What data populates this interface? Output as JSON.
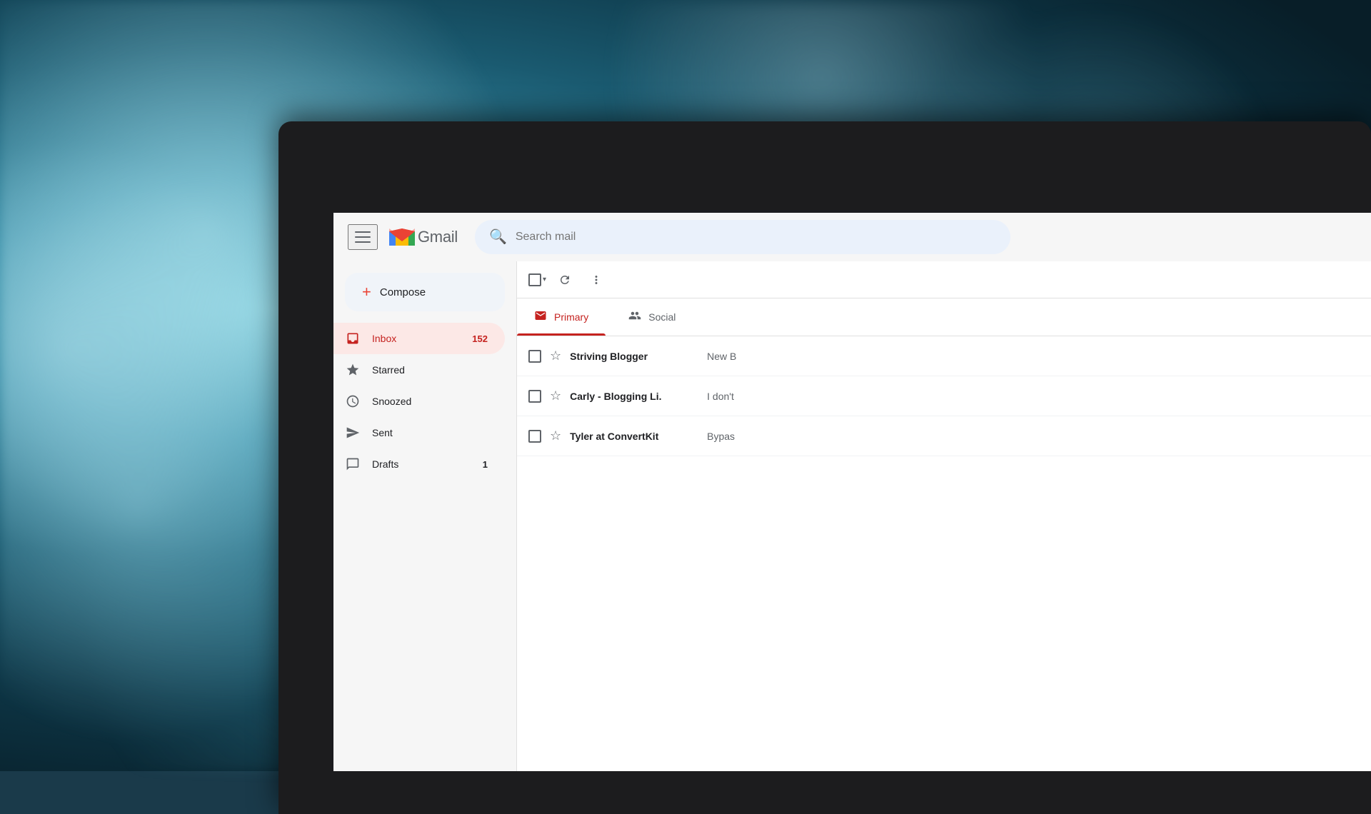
{
  "background": {
    "color": "#1a3a4a"
  },
  "gmail": {
    "app_title": "Gmail",
    "header": {
      "menu_icon": "☰",
      "search_placeholder": "Search mail"
    },
    "compose": {
      "label": "Compose",
      "plus_icon": "+"
    },
    "sidebar": {
      "items": [
        {
          "id": "inbox",
          "label": "Inbox",
          "icon": "inbox",
          "count": "152",
          "active": true
        },
        {
          "id": "starred",
          "label": "Starred",
          "icon": "star",
          "count": "",
          "active": false
        },
        {
          "id": "snoozed",
          "label": "Snoozed",
          "icon": "clock",
          "count": "",
          "active": false
        },
        {
          "id": "sent",
          "label": "Sent",
          "icon": "send",
          "count": "",
          "active": false
        },
        {
          "id": "drafts",
          "label": "Drafts",
          "icon": "drafts",
          "count": "1",
          "active": false
        }
      ]
    },
    "tabs": [
      {
        "id": "primary",
        "label": "Primary",
        "icon": "inbox",
        "active": true
      },
      {
        "id": "social",
        "label": "Social",
        "icon": "people",
        "active": false
      }
    ],
    "emails": [
      {
        "sender": "Striving Blogger",
        "preview": "New B",
        "starred": false
      },
      {
        "sender": "Carly - Blogging Li.",
        "preview": "I don't",
        "starred": false
      },
      {
        "sender": "Tyler at ConvertKit",
        "preview": "Bypas",
        "starred": false
      }
    ]
  }
}
